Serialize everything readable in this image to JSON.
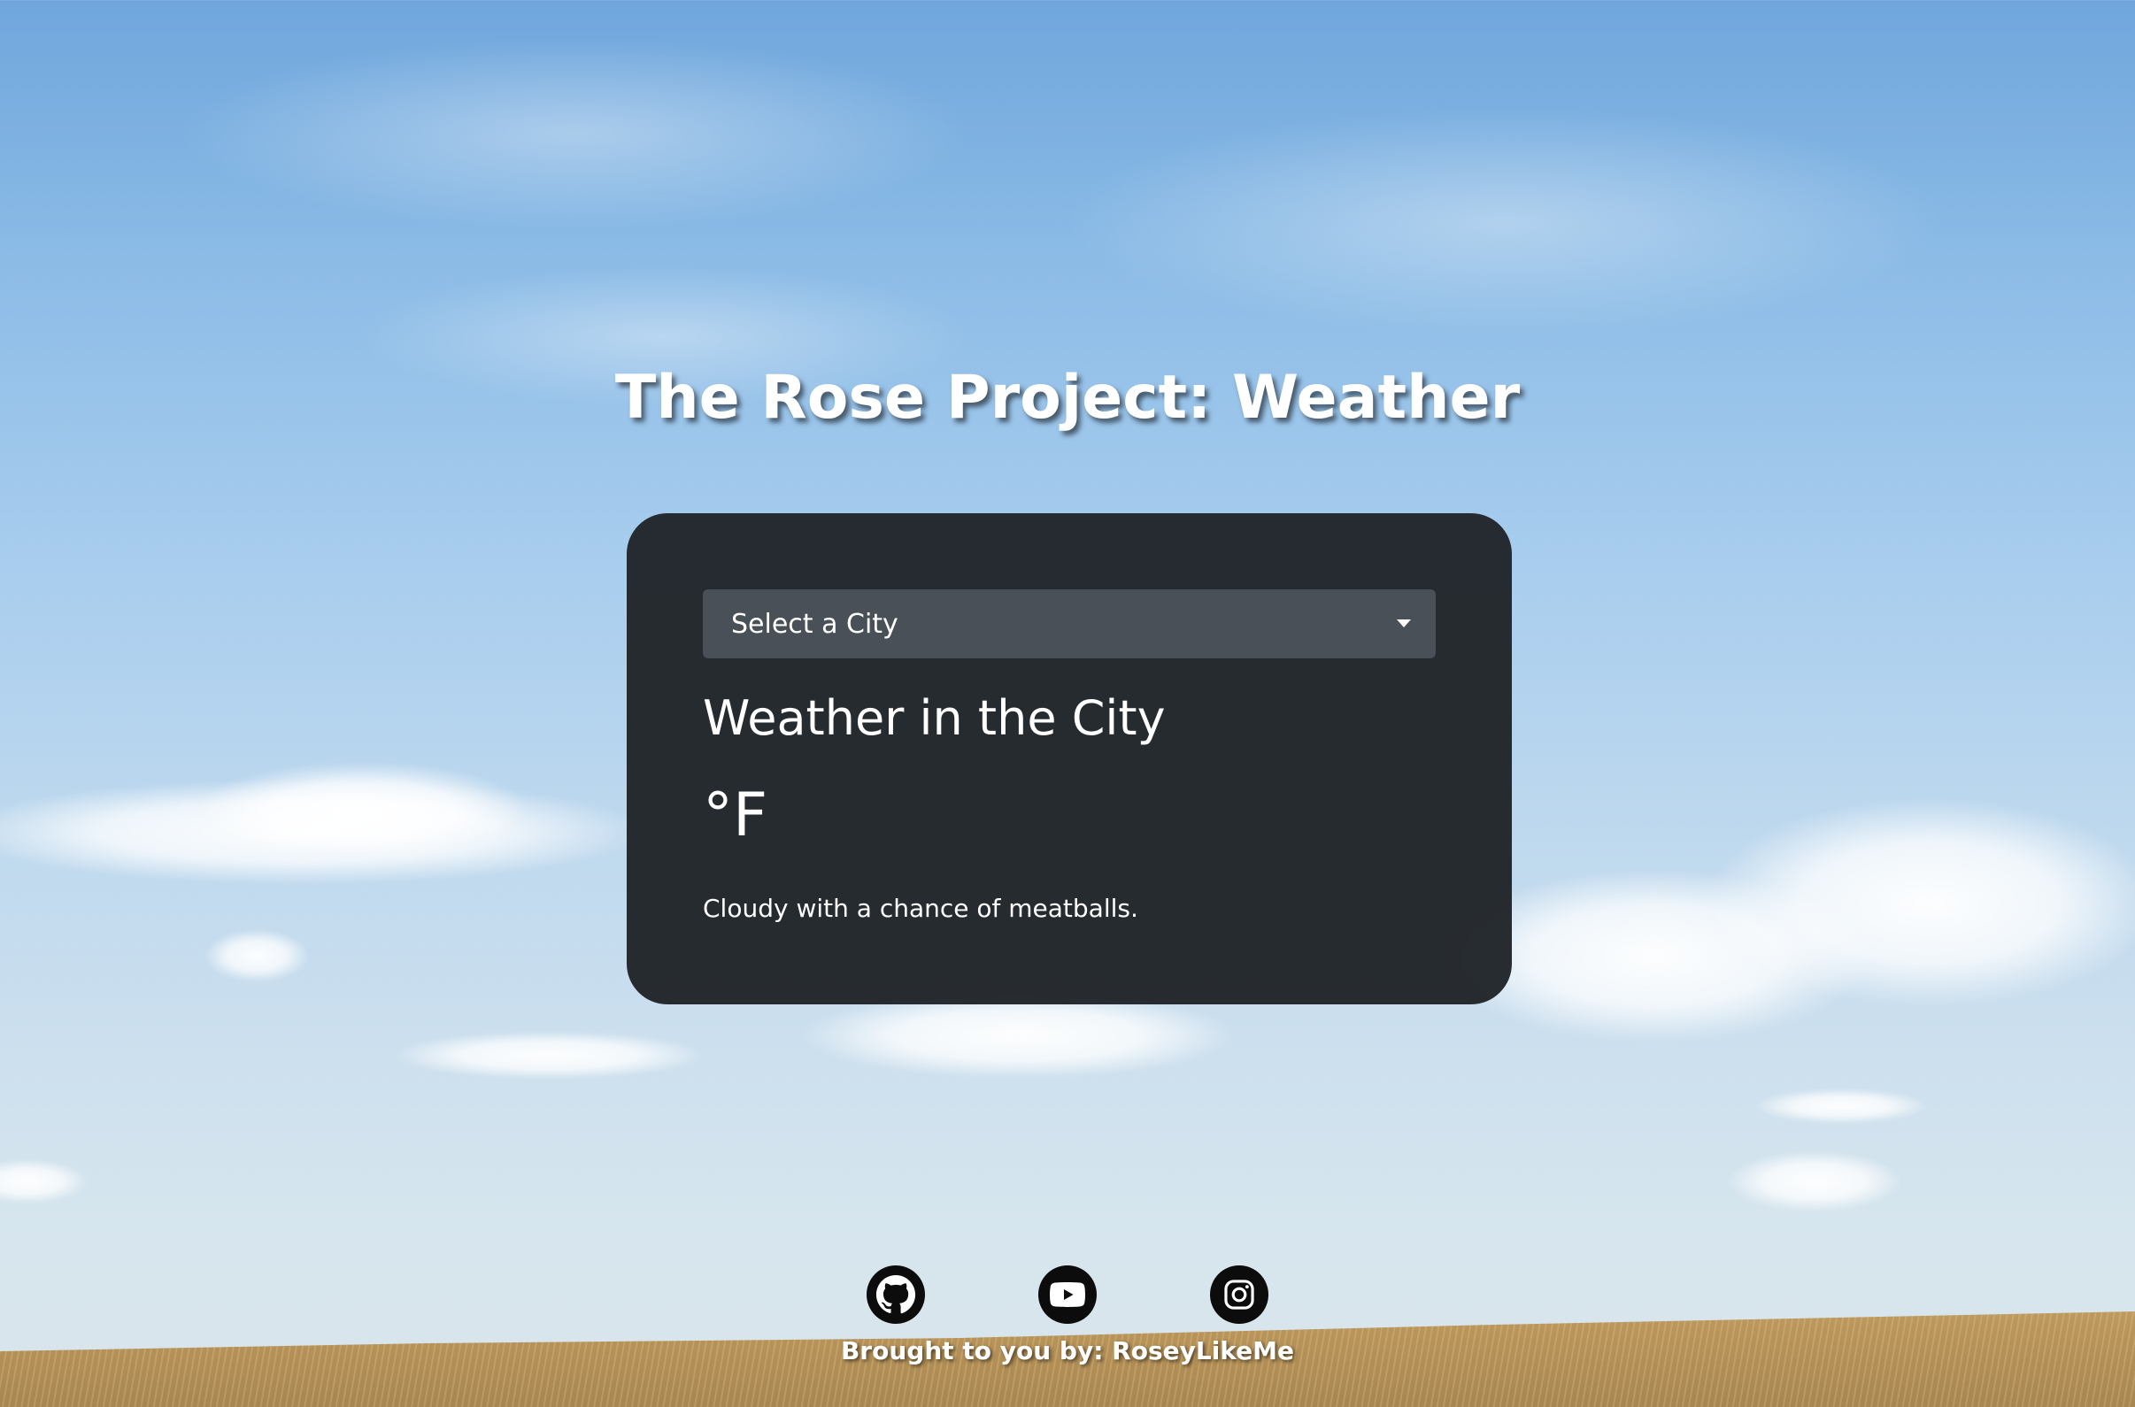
{
  "header": {
    "title": "The Rose Project: Weather"
  },
  "weather_card": {
    "city_select": {
      "selected": "Select a City",
      "options": [
        "Select a City"
      ]
    },
    "heading": "Weather in the City",
    "temperature": "°F",
    "description": "Cloudy with a chance of meatballs."
  },
  "footer": {
    "social_links": [
      {
        "icon": "github-icon"
      },
      {
        "icon": "youtube-icon"
      },
      {
        "icon": "instagram-icon"
      }
    ],
    "credit": "Brought to you by: RoseyLikeMe"
  },
  "colors": {
    "card_background": "#212529",
    "select_background": "#495057",
    "text": "#ffffff"
  }
}
